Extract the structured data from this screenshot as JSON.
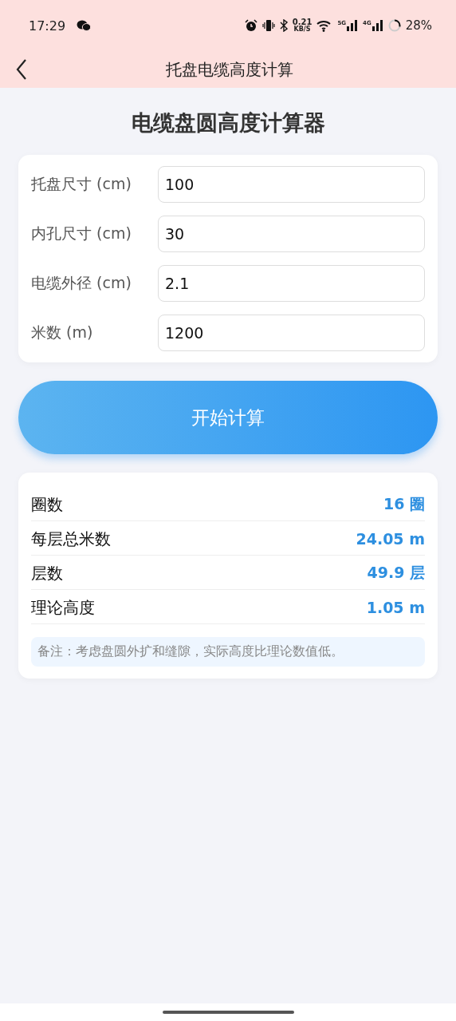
{
  "status_bar": {
    "time": "17:29",
    "speed_value": "0.21",
    "speed_unit": "KB/S",
    "network_1": "5G",
    "network_2": "4G",
    "battery": "28%"
  },
  "nav": {
    "title": "托盘电缆高度计算"
  },
  "heading": "电缆盘圆高度计算器",
  "inputs": [
    {
      "label": "托盘尺寸 (cm)",
      "value": "100"
    },
    {
      "label": "内孔尺寸 (cm)",
      "value": "30"
    },
    {
      "label": "电缆外径 (cm)",
      "value": "2.1"
    },
    {
      "label": "米数 (m)",
      "value": "1200"
    }
  ],
  "button": "开始计算",
  "results": [
    {
      "label": "圈数",
      "value": "16 圈"
    },
    {
      "label": "每层总米数",
      "value": "24.05 m"
    },
    {
      "label": "层数",
      "value": "49.9 层"
    },
    {
      "label": "理论高度",
      "value": "1.05 m"
    }
  ],
  "note": "备注：考虑盘圆外扩和缝隙，实际高度比理论数值低。"
}
